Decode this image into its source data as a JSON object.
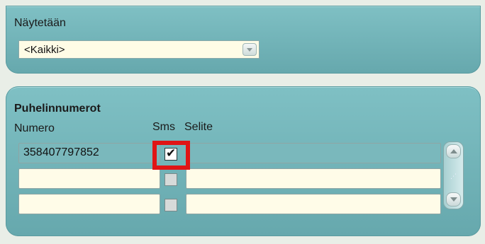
{
  "filter": {
    "label": "Näytetään",
    "selected": "<Kaikki>"
  },
  "phones": {
    "section_title": "Puhelinnumerot",
    "columns": {
      "numero": "Numero",
      "sms": "Sms",
      "selite": "Selite"
    },
    "rows": [
      {
        "numero": "358407797852",
        "sms": true,
        "selite": ""
      },
      {
        "numero": "",
        "sms": false,
        "selite": ""
      },
      {
        "numero": "",
        "sms": false,
        "selite": ""
      }
    ]
  },
  "colors": {
    "panel": "#74b6ba",
    "field_empty": "#fffce8",
    "highlight": "#e01515"
  }
}
